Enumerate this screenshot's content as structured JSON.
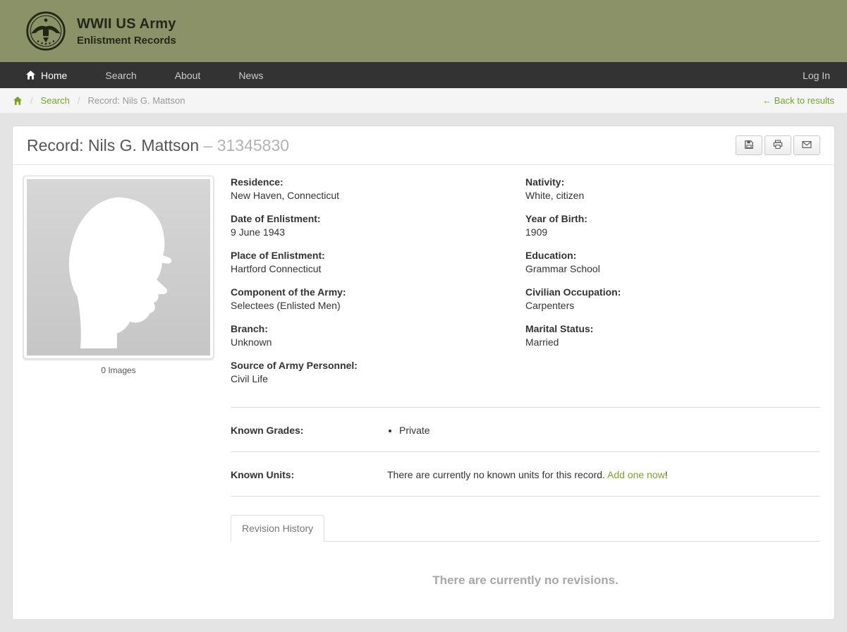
{
  "colors": {
    "header_olive": "#8c9268",
    "nav_dark": "#333333",
    "accent_green": "#76a22e",
    "muted_gray": "#b3b3b3"
  },
  "icons": {
    "logo": "us-army-seal",
    "home": "house-glyph",
    "save": "floppy-disk",
    "print": "printer",
    "email": "envelope",
    "back_arrow": "←",
    "list_bullet": "•",
    "photo_placeholder": "soldier-silhouette"
  },
  "header": {
    "title_line1": "WWII US Army",
    "title_line2": "Enlistment Records"
  },
  "nav": {
    "items": [
      {
        "label": "Home"
      },
      {
        "label": "Search"
      },
      {
        "label": "About"
      },
      {
        "label": "News"
      }
    ],
    "login_label": "Log In"
  },
  "breadcrumb": {
    "search": "Search",
    "current": "Record: Nils G. Mattson",
    "back_label": "← Back to results"
  },
  "record": {
    "title": "Record: Nils G. Mattson",
    "record_number": "– 31345830",
    "images_caption": "0 Images",
    "fields_left": [
      {
        "label": "Residence:",
        "value": "New Haven, Connecticut"
      },
      {
        "label": "Date of Enlistment:",
        "value": "9 June 1943"
      },
      {
        "label": "Place of Enlistment:",
        "value": "Hartford Connecticut"
      },
      {
        "label": "Component of the Army:",
        "value": "Selectees (Enlisted Men)"
      },
      {
        "label": "Branch:",
        "value": "Unknown"
      },
      {
        "label": "Source of Army Personnel:",
        "value": "Civil Life"
      }
    ],
    "fields_right": [
      {
        "label": "Nativity:",
        "value": "White, citizen"
      },
      {
        "label": "Year of Birth:",
        "value": "1909"
      },
      {
        "label": "Education:",
        "value": "Grammar School"
      },
      {
        "label": "Civilian Occupation:",
        "value": "Carpenters"
      },
      {
        "label": "Marital Status:",
        "value": "Married"
      }
    ],
    "known_grades_label": "Known Grades:",
    "known_grades": [
      "Private"
    ],
    "known_units_label": "Known Units:",
    "known_units_text": "There are currently no known units for this record.",
    "known_units_link_label": "Add one now",
    "known_units_link_suffix": "!",
    "tabs": [
      {
        "label": "Revision History"
      }
    ],
    "empty_revisions_text": "There are currently no revisions."
  }
}
